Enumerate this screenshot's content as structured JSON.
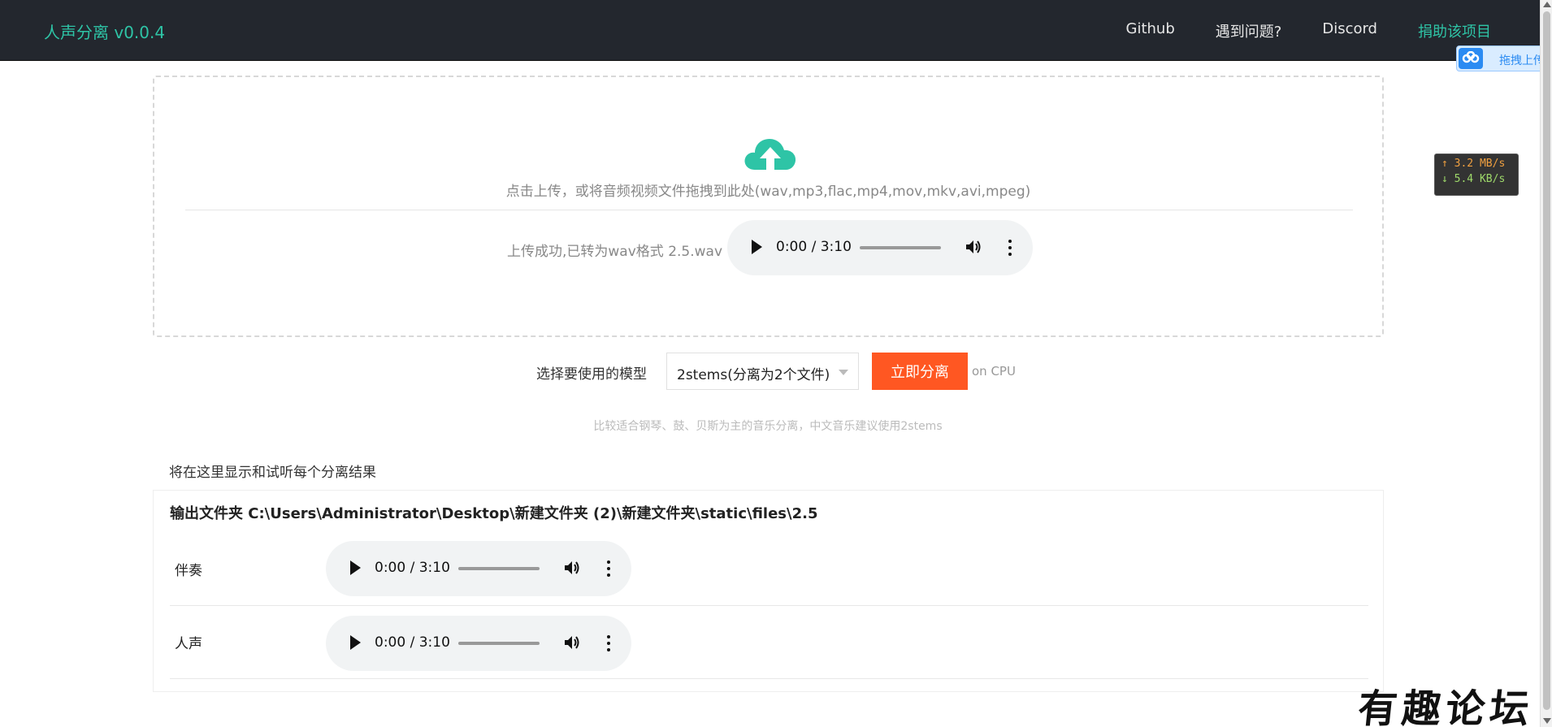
{
  "navbar": {
    "brand": "人声分离 v0.0.4",
    "links": [
      {
        "label": "Github"
      },
      {
        "label": "遇到问题?"
      },
      {
        "label": "Discord"
      },
      {
        "label": "捐助该项目"
      }
    ]
  },
  "float_upload": {
    "label": "拖拽上传"
  },
  "speed": {
    "up": "↑ 3.2 MB/s",
    "down": "↓ 5.4 KB/s"
  },
  "upload": {
    "hint": "点击上传，或将音频视频文件拖拽到此处(wav,mp3,flac,mp4,mov,mkv,avi,mpeg)",
    "status": "上传成功,已转为wav格式 2.5.wav",
    "player_time": "0:00 / 3:10"
  },
  "model": {
    "label": "选择要使用的模型",
    "selected": "2stems(分离为2个文件)",
    "button": "立即分离",
    "device": "on CPU",
    "hint": "比较适合钢琴、鼓、贝斯为主的音乐分离，中文音乐建议使用2stems"
  },
  "results": {
    "header": "将在这里显示和试听每个分离结果",
    "output_folder": "输出文件夹 C:\\Users\\Administrator\\Desktop\\新建文件夹 (2)\\新建文件夹\\static\\files\\2.5",
    "tracks": [
      {
        "name": "伴奏",
        "time": "0:00 / 3:10"
      },
      {
        "name": "人声",
        "time": "0:00 / 3:10"
      }
    ]
  },
  "watermark": "有趣论坛",
  "colors": {
    "accent": "#2ec4a6",
    "button": "#ff5722",
    "navbar": "#23272e"
  }
}
